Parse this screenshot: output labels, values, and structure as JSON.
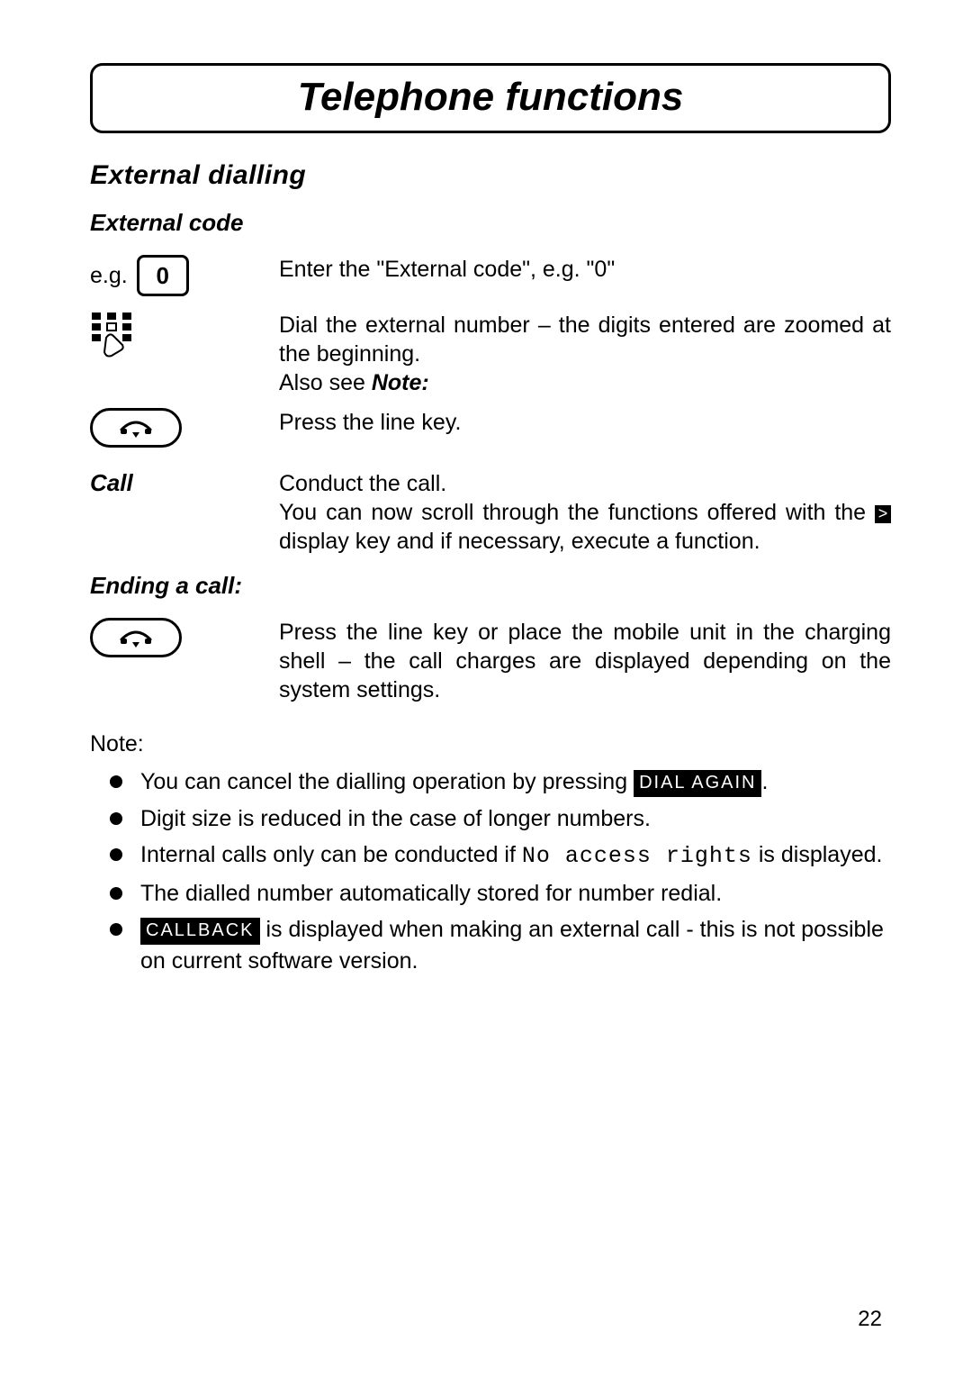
{
  "title": "Telephone functions",
  "section": "External dialling",
  "sub1": "External code",
  "row_eg_label": "e.g.",
  "key_zero": "0",
  "row_eg_desc": "Enter the \"External code\", e.g. \"0\"",
  "row_dial_desc1": "Dial the external number – the digits entered are zoomed at the beginning.",
  "row_dial_desc2_prefix": "Also see ",
  "row_dial_desc2_bold": "Note:",
  "row_linekey_desc": "Press the line key.",
  "call_label": "Call",
  "call_desc1": "Conduct the call.",
  "call_desc2a": "You can now scroll through the functions offered with the ",
  "call_desc2b": " display key and if necessary, execute a function.",
  "sub2": "Ending a call:",
  "end_desc": "Press the line key or place the mobile unit in the charging shell – the call charges are displayed depending on the system settings.",
  "note_label": "Note:",
  "notes": {
    "n1a": "You can cancel the dialling operation by pressing ",
    "n1_badge": "DIAL AGAIN",
    "n1b": ".",
    "n2": "Digit size is reduced in the case of longer numbers.",
    "n3a": "Internal calls only can be conducted if ",
    "n3_mono": "No access rights",
    "n3b": " is displayed.",
    "n4": "The dialled number automatically stored for number redial.",
    "n5_badge": "CALLBACK",
    "n5a": " is displayed when making an external call - this is not possible on current software version."
  },
  "page_number": "22"
}
